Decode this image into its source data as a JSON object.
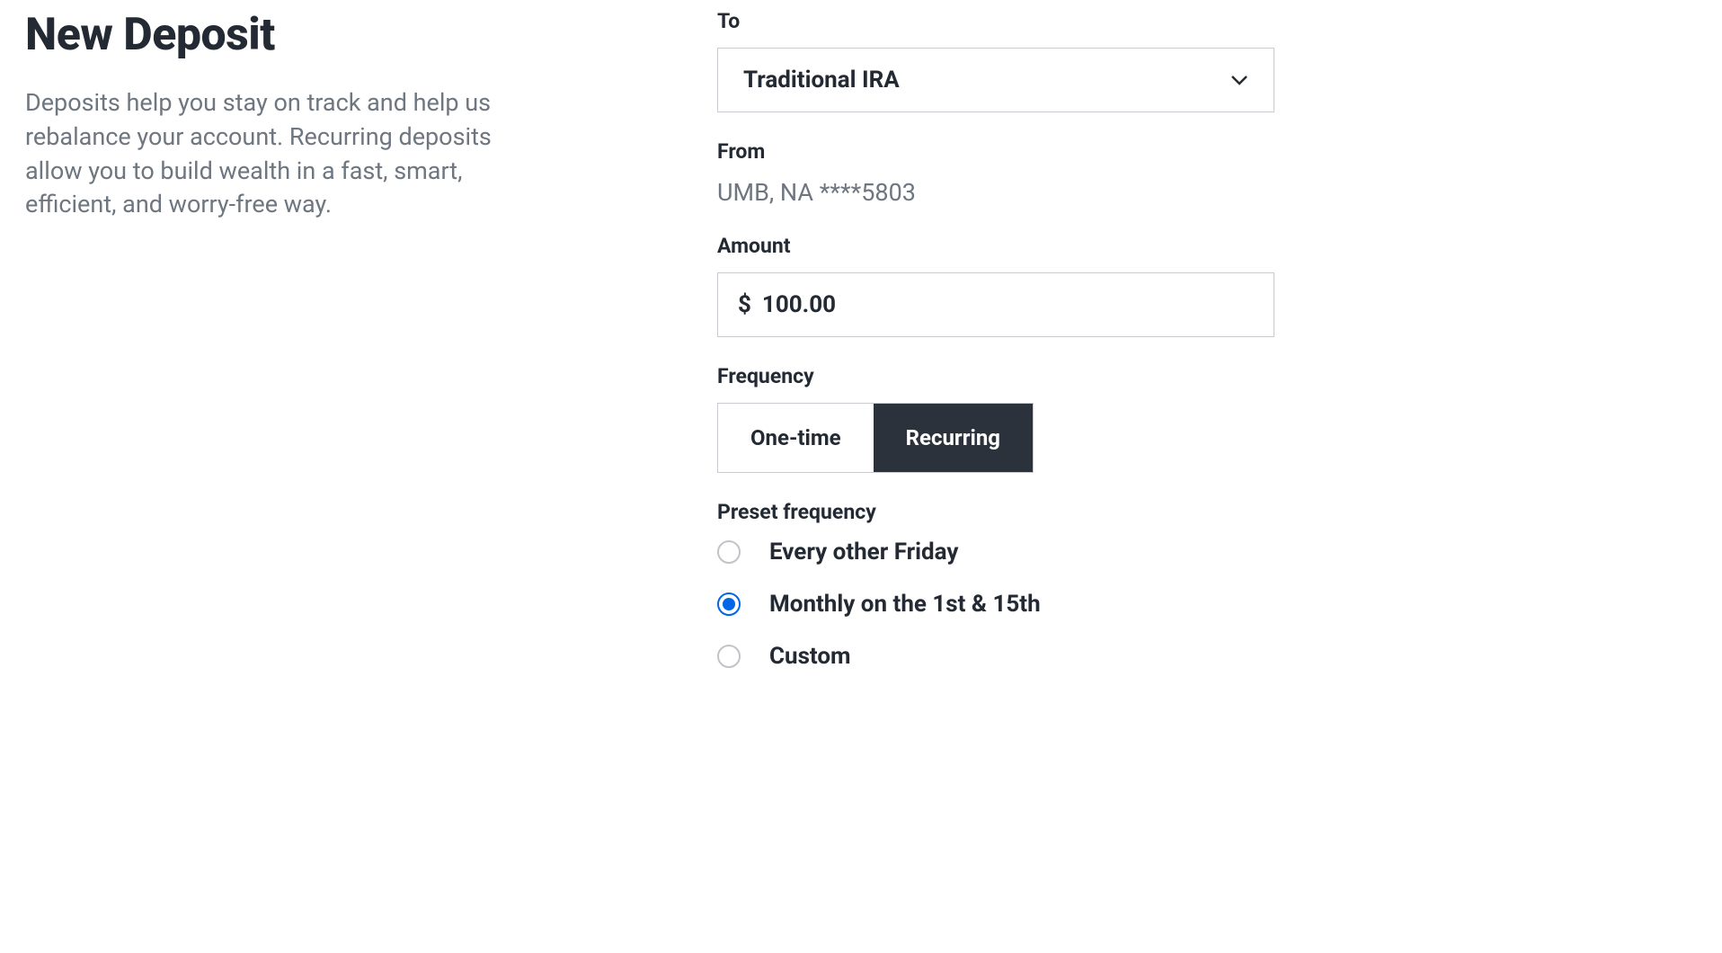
{
  "header": {
    "title": "New Deposit",
    "description": "Deposits help you stay on track and help us rebalance your account. Recurring deposits allow you to build wealth in a fast, smart, efficient, and worry-free way."
  },
  "form": {
    "to": {
      "label": "To",
      "value": "Traditional IRA"
    },
    "from": {
      "label": "From",
      "value": "UMB, NA ****5803"
    },
    "amount": {
      "label": "Amount",
      "currency": "$",
      "value": "100.00"
    },
    "frequency": {
      "label": "Frequency",
      "options": {
        "oneTime": "One-time",
        "recurring": "Recurring"
      },
      "selected": "recurring"
    },
    "presetFrequency": {
      "label": "Preset frequency",
      "options": [
        {
          "label": "Every other Friday",
          "checked": false
        },
        {
          "label": "Monthly on the 1st & 15th",
          "checked": true
        },
        {
          "label": "Custom",
          "checked": false
        }
      ]
    }
  }
}
